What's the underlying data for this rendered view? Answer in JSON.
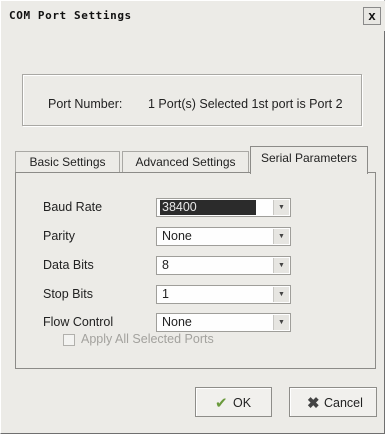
{
  "window": {
    "title": "COM Port Settings",
    "close_glyph": "x"
  },
  "port": {
    "label": "Port Number:",
    "value": "1 Port(s) Selected  1st port is Port 2"
  },
  "tabs": [
    {
      "label": "Basic Settings",
      "active": false
    },
    {
      "label": "Advanced Settings",
      "active": false
    },
    {
      "label": "Serial Parameters",
      "active": true
    }
  ],
  "fields": [
    {
      "label": "Baud Rate",
      "value": "38400"
    },
    {
      "label": "Parity",
      "value": "None"
    },
    {
      "label": "Data Bits",
      "value": "8"
    },
    {
      "label": "Stop Bits",
      "value": "1"
    },
    {
      "label": "Flow Control",
      "value": "None"
    }
  ],
  "apply_all": {
    "label": "Apply All Selected Ports",
    "checked": false,
    "enabled": false
  },
  "buttons": {
    "ok": "OK",
    "cancel": "Cancel"
  },
  "icons": {
    "ok": "check-icon",
    "cancel": "x-icon",
    "dropdown": "chevron-down-icon"
  },
  "colors": {
    "dialog_bg": "#ecebe7",
    "selection": "#2b2b2b",
    "disabled_text": "#a3a29e",
    "ok_icon": "#6a9a3c",
    "cancel_icon": "#444444"
  }
}
